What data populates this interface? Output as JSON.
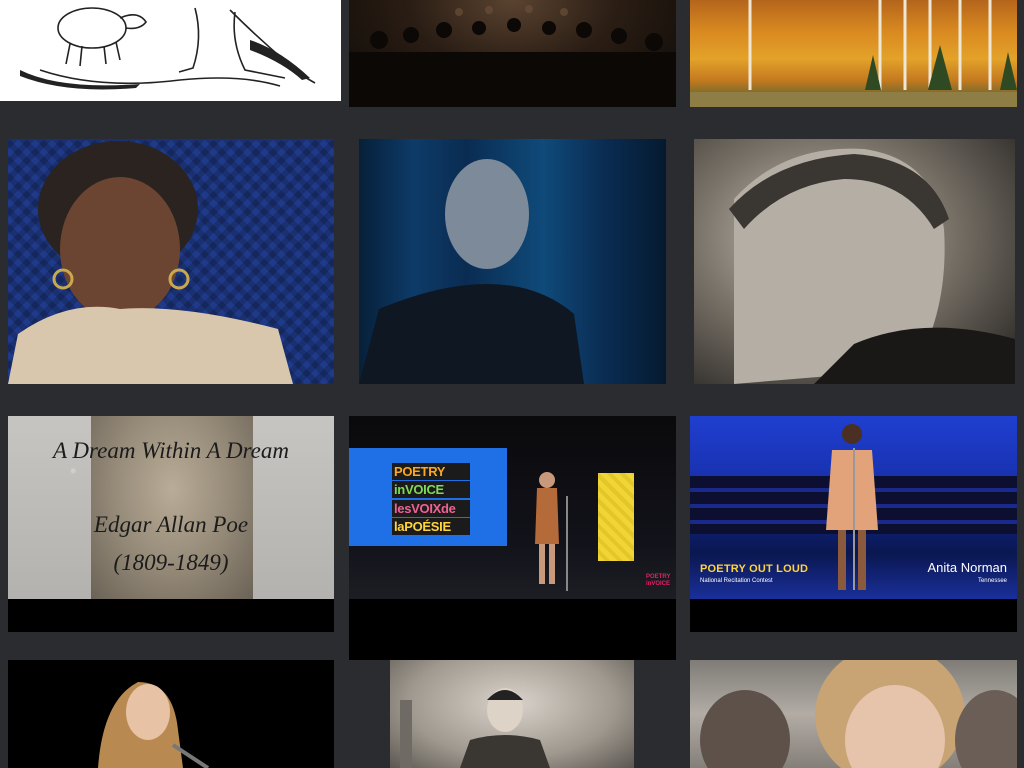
{
  "gallery": {
    "rows": [
      [
        {
          "name": "engraving-animals-thumbnail"
        },
        {
          "name": "congregation-thumbnail"
        },
        {
          "name": "autumn-forest-thumbnail"
        }
      ],
      [
        {
          "name": "portrait-woman-thumbnail"
        },
        {
          "name": "stage-speaker-thumbnail"
        },
        {
          "name": "sepia-portrait-thumbnail"
        }
      ],
      [
        {
          "name": "poem-title-card-thumbnail",
          "title": "A Dream Within A Dream",
          "author": "Edgar Allan Poe",
          "years": "(1809-1849)"
        },
        {
          "name": "poetry-in-voice-thumbnail",
          "logo_lines": [
            "POETRY",
            "inVOICE",
            "lesVOIXde",
            "laPOÉSIE"
          ],
          "corner_logo": "POETRY inVOICE"
        },
        {
          "name": "poetry-out-loud-thumbnail",
          "logo": "POETRY OUT LOUD",
          "subtitle": "National Recitation Contest",
          "speaker": "Anita Norman",
          "state": "Tennessee"
        }
      ],
      [
        {
          "name": "performer-mic-thumbnail"
        },
        {
          "name": "film-still-thumbnail"
        },
        {
          "name": "children-faces-thumbnail"
        }
      ]
    ]
  },
  "colors": {
    "background": "#2a2c30",
    "tile_black": "#000000",
    "screen_blue": "#1f6fe6",
    "poetry_yellow": "#ffd43b"
  }
}
